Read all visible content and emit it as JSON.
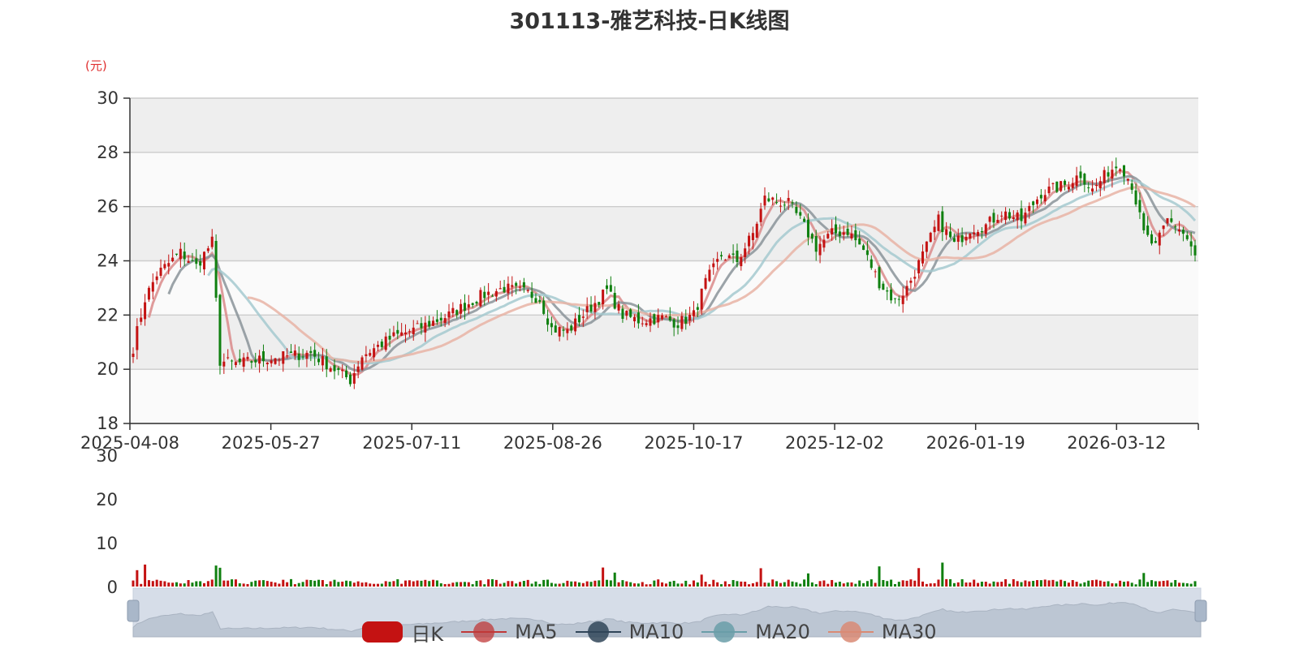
{
  "title": "301113-雅艺科技-日K线图",
  "unit": "(元)",
  "chart_data": {
    "type": "candlestick",
    "title": "301113-雅艺科技-日K线图",
    "ylabel": "(元)",
    "ylim": [
      18,
      30
    ],
    "yticks": [
      18,
      20,
      22,
      24,
      26,
      28,
      30
    ],
    "xticks": [
      "2025-04-08",
      "2025-05-27",
      "2025-07-11",
      "2025-08-26",
      "2025-10-17",
      "2025-12-02",
      "2026-01-19",
      "2026-03-12"
    ],
    "volume_ylim": [
      0,
      30
    ],
    "volume_yticks": [
      0,
      10,
      20,
      30
    ],
    "colors": {
      "up": "#c41212",
      "down": "#108010",
      "ma5": "#d98a8a",
      "ma10": "#8a9399",
      "ma20": "#a5c9cf",
      "ma30": "#e8b3a5"
    },
    "close_anchors": [
      [
        0,
        20.8
      ],
      [
        3,
        22.6
      ],
      [
        6,
        23.5
      ],
      [
        12,
        24.3
      ],
      [
        16,
        23.8
      ],
      [
        20,
        24.7
      ],
      [
        22,
        20.3
      ],
      [
        26,
        20.2
      ],
      [
        34,
        20.4
      ],
      [
        40,
        20.5
      ],
      [
        45,
        20.6
      ],
      [
        52,
        19.9
      ],
      [
        55,
        19.6
      ],
      [
        58,
        20.5
      ],
      [
        66,
        21.2
      ],
      [
        72,
        21.5
      ],
      [
        80,
        22.0
      ],
      [
        88,
        22.7
      ],
      [
        94,
        23.0
      ],
      [
        100,
        22.8
      ],
      [
        103,
        22.6
      ],
      [
        106,
        21.5
      ],
      [
        110,
        21.4
      ],
      [
        116,
        22.3
      ],
      [
        120,
        22.9
      ],
      [
        124,
        22.0
      ],
      [
        128,
        21.8
      ],
      [
        134,
        21.9
      ],
      [
        138,
        21.7
      ],
      [
        142,
        22.0
      ],
      [
        145,
        23.2
      ],
      [
        149,
        24.2
      ],
      [
        153,
        24.0
      ],
      [
        157,
        25.0
      ],
      [
        160,
        26.3
      ],
      [
        166,
        26.1
      ],
      [
        169,
        25.5
      ],
      [
        173,
        24.5
      ],
      [
        177,
        25.0
      ],
      [
        181,
        25.1
      ],
      [
        185,
        24.4
      ],
      [
        189,
        23.2
      ],
      [
        193,
        22.5
      ],
      [
        196,
        23.0
      ],
      [
        200,
        24.2
      ],
      [
        204,
        25.5
      ],
      [
        208,
        24.6
      ],
      [
        212,
        25.2
      ],
      [
        216,
        25.3
      ],
      [
        220,
        25.8
      ],
      [
        225,
        25.5
      ],
      [
        230,
        26.5
      ],
      [
        236,
        26.8
      ],
      [
        240,
        27.2
      ],
      [
        243,
        26.6
      ],
      [
        247,
        27.3
      ],
      [
        250,
        27.6
      ],
      [
        253,
        26.8
      ],
      [
        256,
        25.0
      ],
      [
        259,
        24.5
      ],
      [
        262,
        25.5
      ],
      [
        265,
        25.2
      ],
      [
        267,
        24.8
      ],
      [
        269,
        24.2
      ]
    ],
    "ma_series": [
      "MA5",
      "MA10",
      "MA20",
      "MA30"
    ],
    "volume_approx": "mostly 0.5-2.0, spikes up to ~4.5"
  },
  "legend": [
    {
      "name": "日K",
      "icon": "candle",
      "color": "#c41212"
    },
    {
      "name": "MA5",
      "icon": "line",
      "color": "#c03838"
    },
    {
      "name": "MA10",
      "icon": "line",
      "color": "#304558"
    },
    {
      "name": "MA20",
      "icon": "line",
      "color": "#6a9da8"
    },
    {
      "name": "MA30",
      "icon": "line",
      "color": "#d98a74"
    }
  ]
}
